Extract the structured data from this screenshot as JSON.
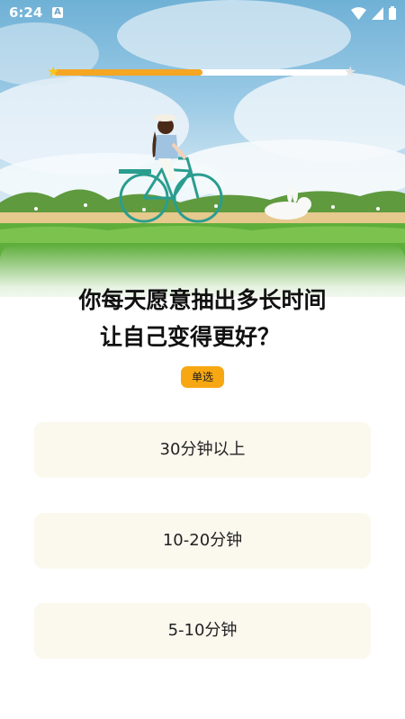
{
  "status_bar": {
    "time": "6:24",
    "notification_icon_label": "A",
    "icons": [
      "wifi-icon",
      "cell-signal-icon",
      "battery-icon"
    ]
  },
  "progress": {
    "fraction": 0.5,
    "fill_color": "#f5a623",
    "track_color": "#ffffff",
    "start_icon": "star-icon",
    "end_icon": "star-icon"
  },
  "quiz": {
    "question_line1": "你每天愿意抽出多长时间",
    "question_line2": "让自己变得更好？",
    "mode_badge": "单选",
    "badge_color": "#f7a712",
    "options": [
      {
        "label": "30分钟以上"
      },
      {
        "label": "10-20分钟"
      },
      {
        "label": "5-10分钟"
      }
    ]
  }
}
